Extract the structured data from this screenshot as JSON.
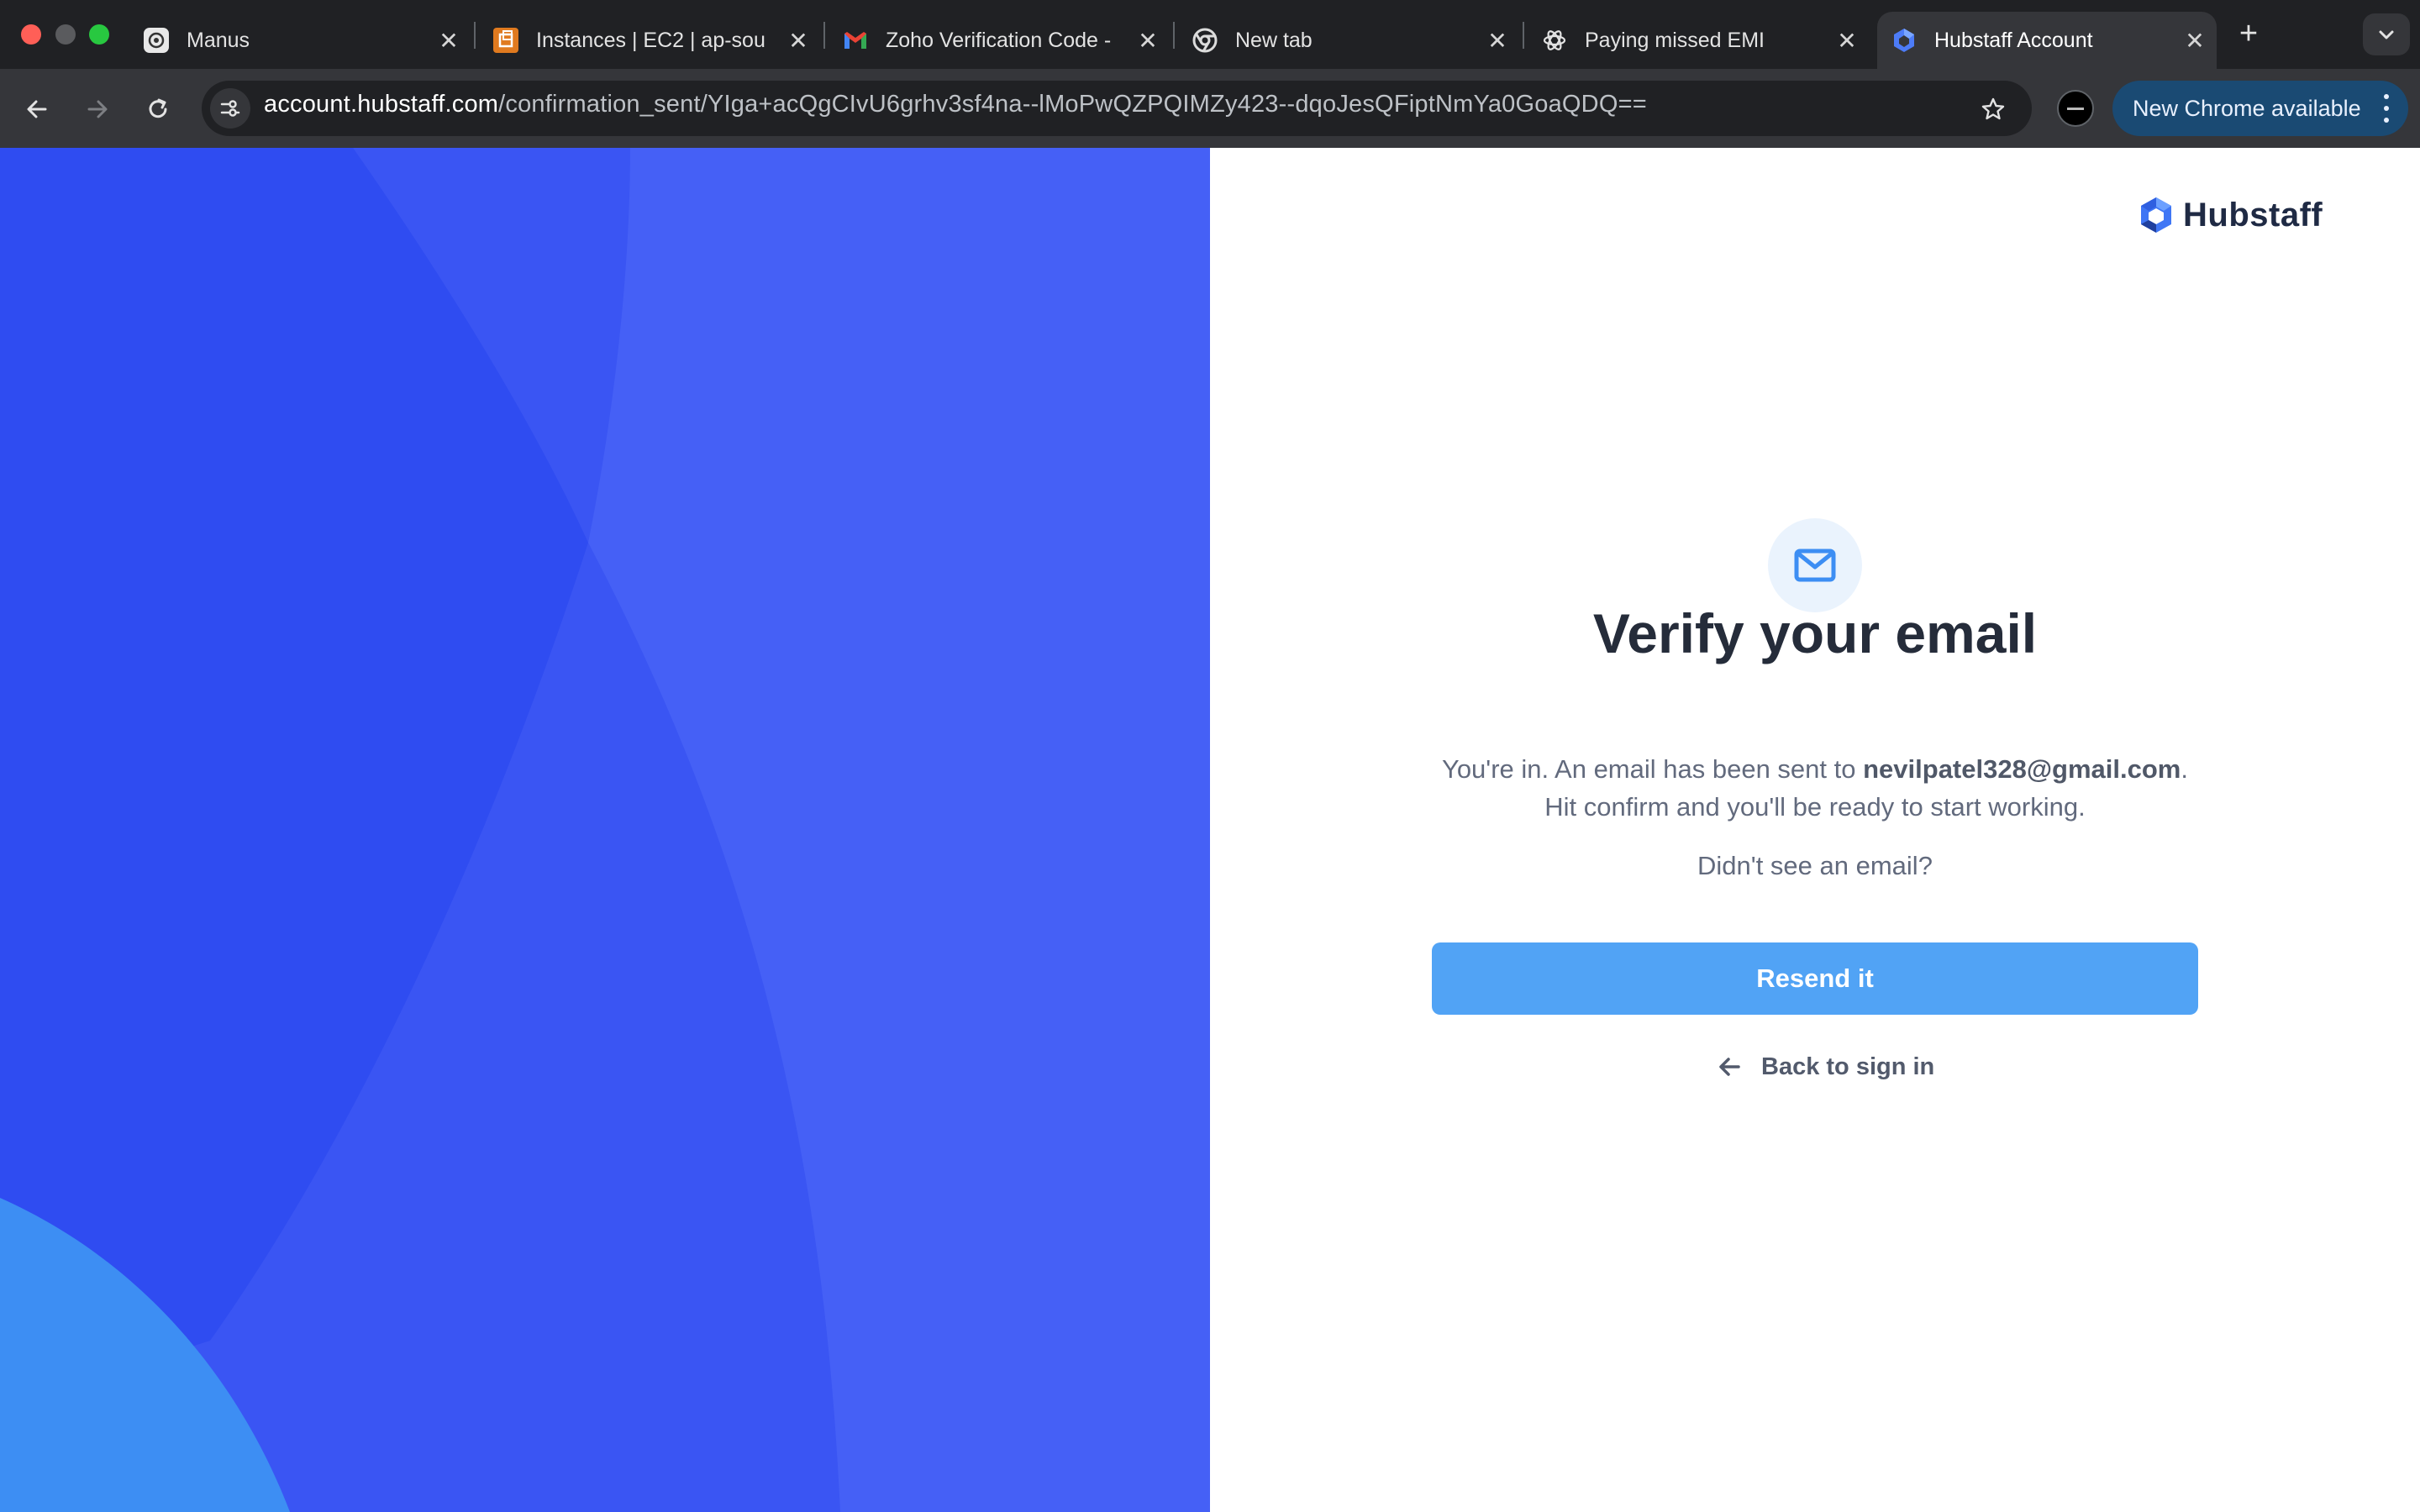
{
  "browser": {
    "tabs": [
      {
        "title": "Manus",
        "favicon": "manus-icon",
        "active": false
      },
      {
        "title": "Instances | EC2 | ap-sou",
        "favicon": "aws-ec2-icon",
        "active": false
      },
      {
        "title": "Zoho Verification Code -",
        "favicon": "gmail-icon",
        "active": false
      },
      {
        "title": "New tab",
        "favicon": "chrome-icon",
        "active": false
      },
      {
        "title": "Paying missed EMI",
        "favicon": "openai-icon",
        "active": false
      },
      {
        "title": "Hubstaff Account",
        "favicon": "hubstaff-icon",
        "active": true
      }
    ],
    "url_host": "account.hubstaff.com",
    "url_path": "/confirmation_sent/YIga+acQgCIvU6grhv3sf4na--lMoPwQZPQIMZy423--dqoJesQFiptNmYa0GoaQDQ==",
    "update_label": "New Chrome available"
  },
  "page": {
    "brand": "Hubstaff",
    "heading": "Verify your email",
    "message_prefix": "You're in. An email has been sent to ",
    "email": "nevilpatel328@gmail.com",
    "message_suffix": ".",
    "message_line2": "Hit confirm and you'll be ready to start working.",
    "no_email_prompt": "Didn't see an email?",
    "resend_label": "Resend it",
    "back_label": "Back to sign in"
  },
  "colors": {
    "hero_blue": "#3a55f3",
    "accent": "#51a3f5",
    "heading": "#252c3a",
    "body_text": "#626a7d"
  }
}
